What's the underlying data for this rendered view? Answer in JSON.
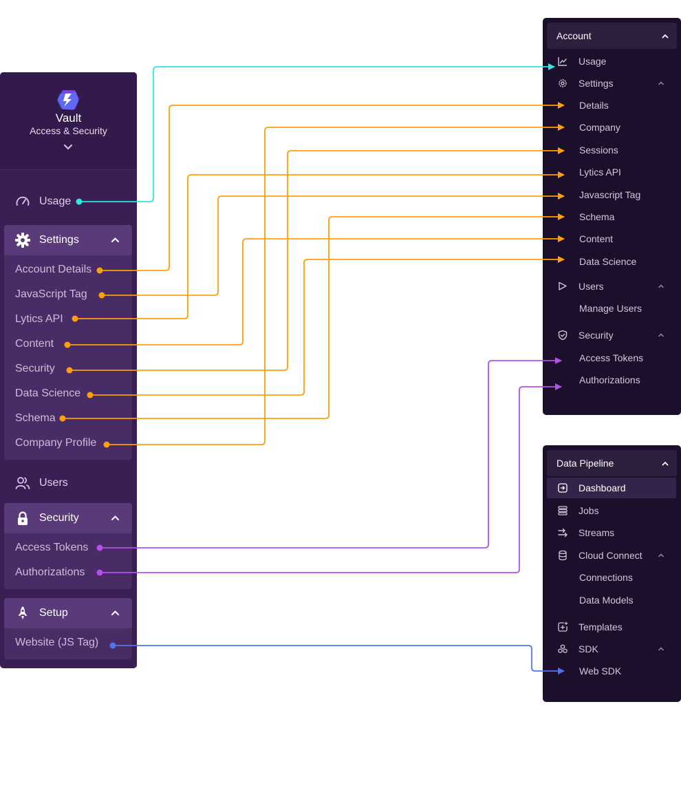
{
  "colors": {
    "usage": "#2ee8d9",
    "settings": "#ff9f0a",
    "security": "#b64ef0",
    "setup": "#4f74f2"
  },
  "left": {
    "app_title": "Vault",
    "app_subtitle": "Access & Security",
    "usage_label": "Usage",
    "settings": {
      "title": "Settings",
      "items": [
        {
          "label": "Account Details"
        },
        {
          "label": "JavaScript Tag"
        },
        {
          "label": "Lytics API"
        },
        {
          "label": "Content"
        },
        {
          "label": "Security"
        },
        {
          "label": "Data Science"
        },
        {
          "label": "Schema"
        },
        {
          "label": "Company Profile"
        }
      ]
    },
    "users_label": "Users",
    "security": {
      "title": "Security",
      "items": [
        {
          "label": "Access Tokens"
        },
        {
          "label": "Authorizations"
        }
      ]
    },
    "setup": {
      "title": "Setup",
      "items": [
        {
          "label": "Website (JS Tag)"
        }
      ]
    }
  },
  "account_panel": {
    "title": "Account",
    "usage": "Usage",
    "settings": "Settings",
    "settings_items": [
      "Details",
      "Company",
      "Sessions",
      "Lytics API",
      "Javascript Tag",
      "Schema",
      "Content",
      "Data Science"
    ],
    "users": "Users",
    "users_items": [
      "Manage Users"
    ],
    "security": "Security",
    "security_items": [
      "Access Tokens",
      "Authorizations"
    ]
  },
  "pipeline_panel": {
    "title": "Data Pipeline",
    "dashboard": "Dashboard",
    "jobs": "Jobs",
    "streams": "Streams",
    "cloud_connect": "Cloud Connect",
    "cloud_items": [
      "Connections",
      "Data Models"
    ],
    "templates": "Templates",
    "sdk": "SDK",
    "sdk_items": [
      "Web SDK"
    ]
  },
  "mappings": [
    {
      "from": "Usage",
      "to": "Usage",
      "group": "usage"
    },
    {
      "from": "Account Details",
      "to": "Details",
      "group": "settings"
    },
    {
      "from": "JavaScript Tag",
      "to": "Javascript Tag",
      "group": "settings"
    },
    {
      "from": "Lytics API",
      "to": "Lytics API",
      "group": "settings"
    },
    {
      "from": "Content",
      "to": "Content",
      "group": "settings"
    },
    {
      "from": "Security",
      "to": "Sessions",
      "group": "settings"
    },
    {
      "from": "Data Science",
      "to": "Data Science",
      "group": "settings"
    },
    {
      "from": "Schema",
      "to": "Schema",
      "group": "settings"
    },
    {
      "from": "Company Profile",
      "to": "Company",
      "group": "settings"
    },
    {
      "from": "Access Tokens",
      "to": "Access Tokens",
      "group": "security"
    },
    {
      "from": "Authorizations",
      "to": "Authorizations",
      "group": "security"
    },
    {
      "from": "Website (JS Tag)",
      "to": "Web SDK",
      "group": "setup"
    }
  ]
}
